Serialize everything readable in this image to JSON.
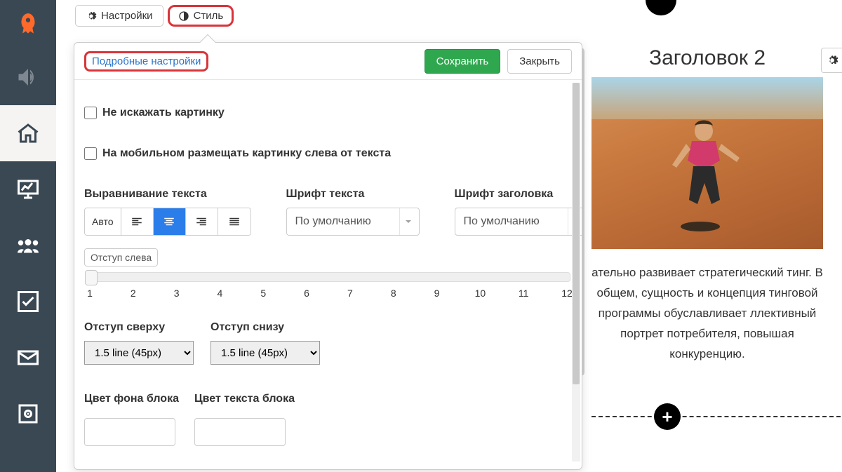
{
  "sidebar": {
    "items": [
      {
        "name": "rocket"
      },
      {
        "name": "sound"
      },
      {
        "name": "home"
      },
      {
        "name": "presentation"
      },
      {
        "name": "users"
      },
      {
        "name": "checkbox"
      },
      {
        "name": "mail"
      },
      {
        "name": "safe"
      }
    ]
  },
  "tabs": {
    "settings": {
      "label": "Настройки"
    },
    "style": {
      "label": "Стиль"
    }
  },
  "panel": {
    "detailed_link": "Подробные настройки",
    "save": "Сохранить",
    "close": "Закрыть",
    "dont_distort": "Не искажать картинку",
    "mobile_left": "На мобильном размещать картинку слева от текста",
    "text_align_label": "Выравнивание текста",
    "text_font_label": "Шрифт текста",
    "header_font_label": "Шрифт заголовка",
    "auto": "Авто",
    "default_font": "По умолчанию",
    "left_indent": "Отступ слева",
    "top_indent": "Отступ сверху",
    "bottom_indent": "Отступ снизу",
    "indent_value": "1.5 line (45px)",
    "bg_color": "Цвет фона блока",
    "text_color": "Цвет текста блока",
    "slider_ticks": [
      "1",
      "2",
      "3",
      "4",
      "5",
      "6",
      "7",
      "8",
      "9",
      "10",
      "11",
      "12"
    ]
  },
  "content": {
    "title": "Заголовок 2",
    "text": "ательно развивает стратегический тинг. В общем, сущность и концепция тинговой программы обуславливает ллективный портрет потребителя, повышая конкуренцию."
  }
}
